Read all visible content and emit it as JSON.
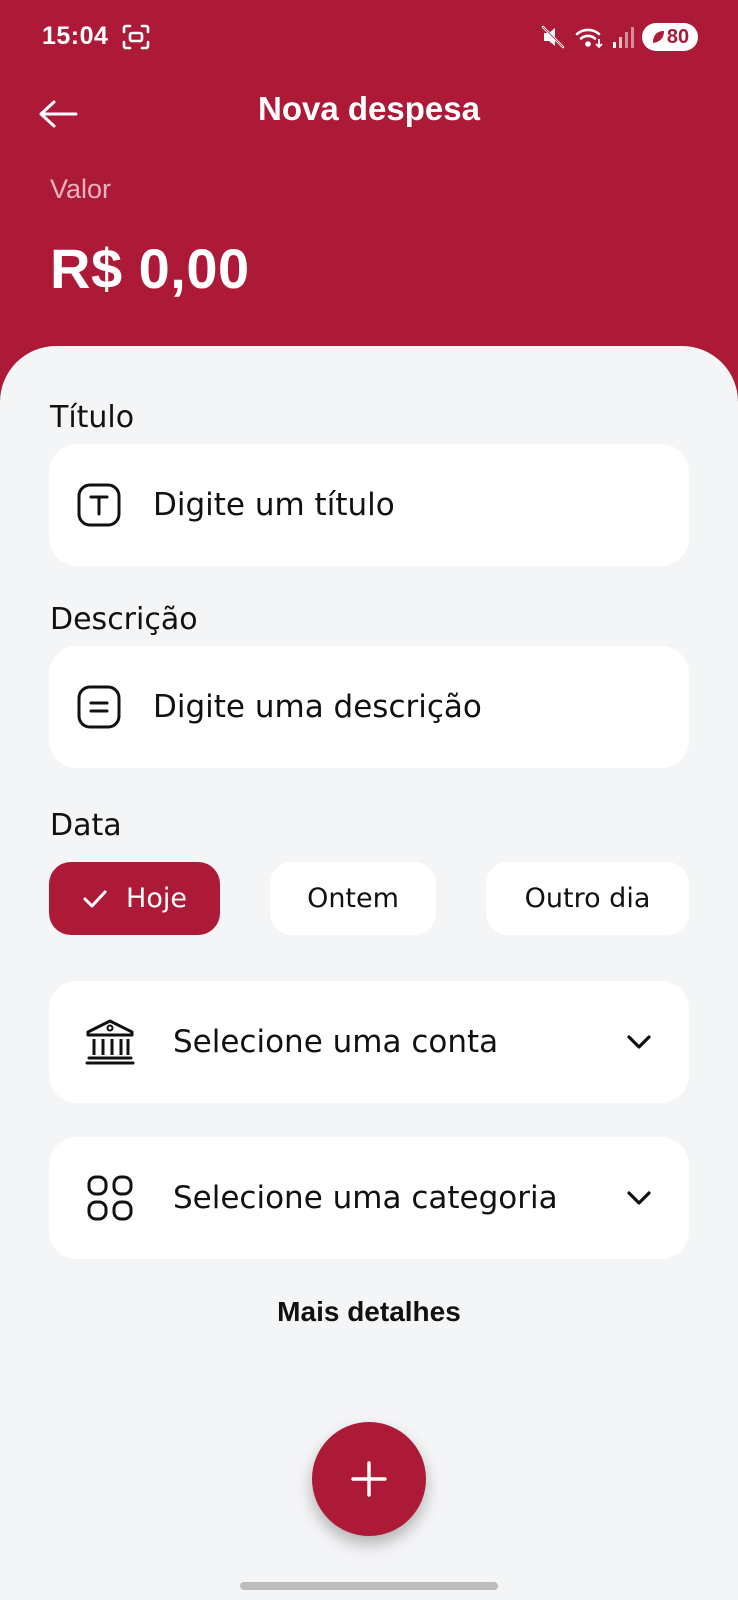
{
  "status_bar": {
    "time": "15:04",
    "battery": "80"
  },
  "nav": {
    "title": "Nova despesa",
    "back_icon": "arrow-left-icon"
  },
  "amount": {
    "label": "Valor",
    "value": "R$ 0,00"
  },
  "form": {
    "title_label": "Título",
    "title_placeholder": "Digite um título",
    "description_label": "Descrição",
    "description_placeholder": "Digite uma descrição",
    "date_label": "Data",
    "date_options": [
      {
        "label": "Hoje",
        "selected": true
      },
      {
        "label": "Ontem",
        "selected": false
      },
      {
        "label": "Outro dia",
        "selected": false
      }
    ],
    "account_select": "Selecione uma conta",
    "category_select": "Selecione uma categoria",
    "more_details": "Mais detalhes"
  },
  "colors": {
    "primary": "#ad1a37",
    "background": "#f4f5f7",
    "card": "#ffffff"
  }
}
